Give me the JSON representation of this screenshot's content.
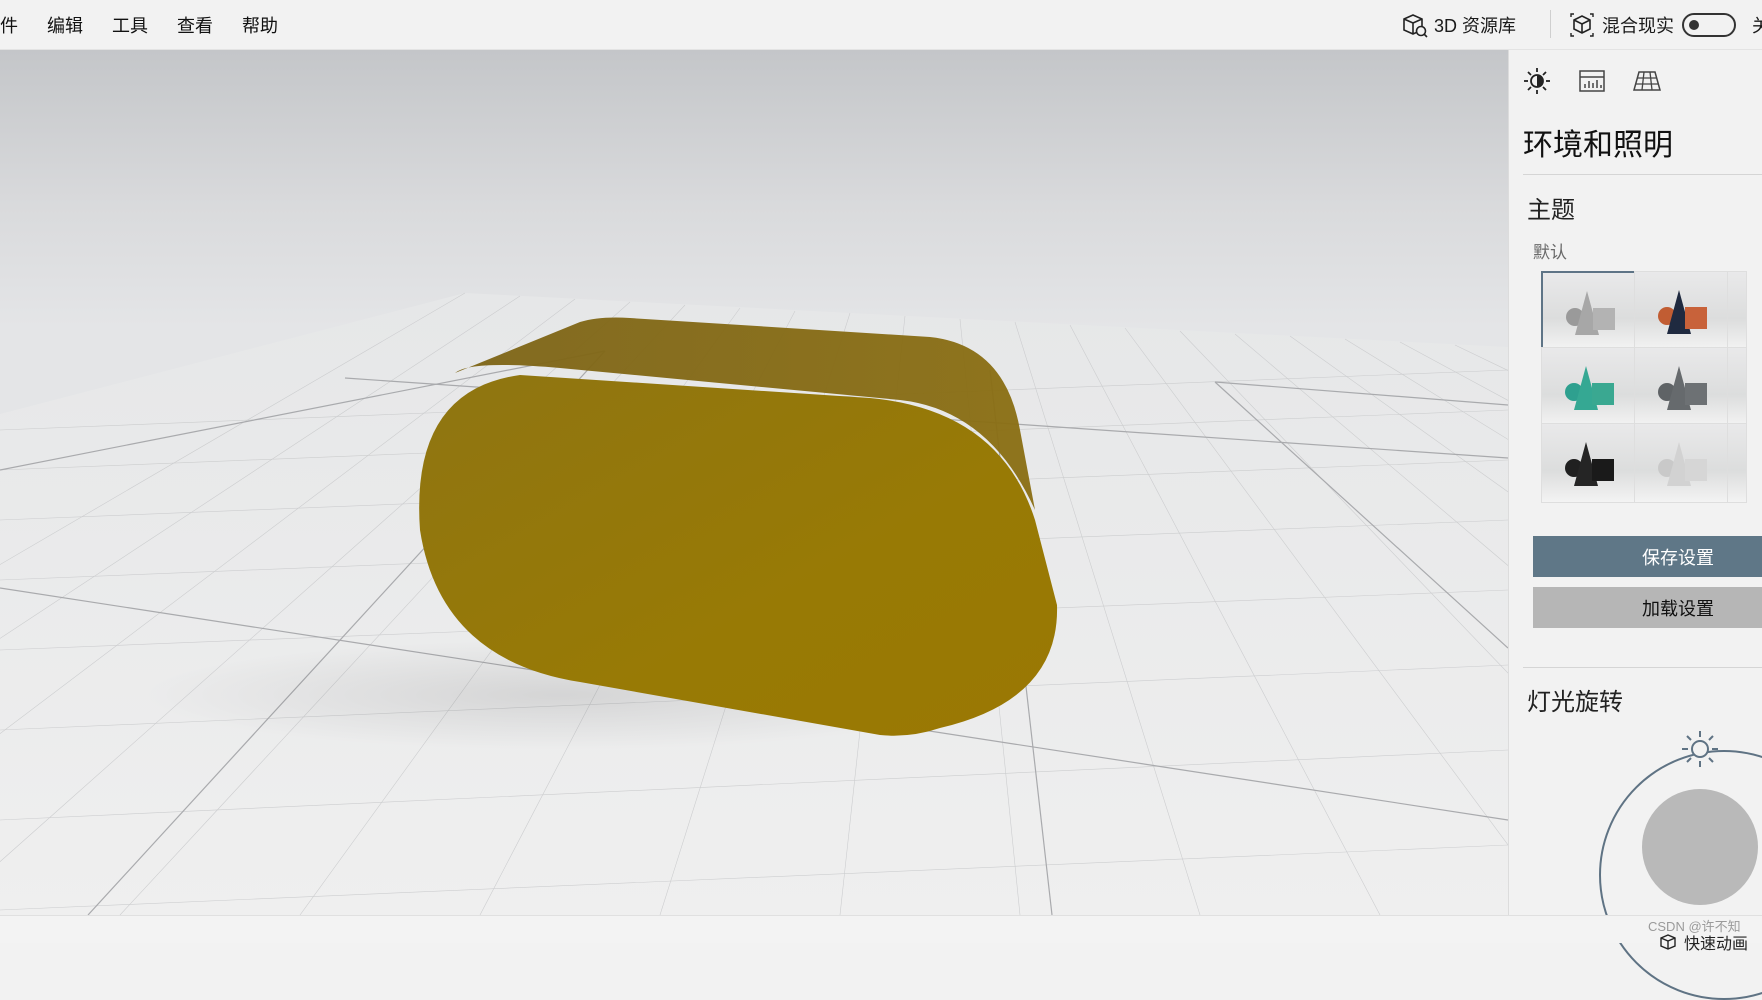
{
  "menu": {
    "items": [
      "件",
      "编辑",
      "工具",
      "查看",
      "帮助"
    ]
  },
  "toolbar": {
    "library_label": "3D 资源库",
    "library_icon": "cube-library-icon",
    "mixed_reality_label": "混合现实",
    "mixed_reality_icon": "mixed-reality-icon",
    "mixed_reality_on": false,
    "toggle_label_partial": "关"
  },
  "viewport": {
    "object_color": "#9a7804",
    "object_shape": "rounded capsule box"
  },
  "panel": {
    "tabs": [
      {
        "icon": "lighting-sun-icon",
        "active": true
      },
      {
        "icon": "stats-chart-icon",
        "active": false
      },
      {
        "icon": "grid-floor-icon",
        "active": false
      }
    ],
    "title": "环境和照明",
    "theme_title": "主题",
    "theme_sub": "默认",
    "themes": [
      {
        "name": "grey",
        "colors": [
          "#9a9a9a",
          "#a7a7a7",
          "#b3b3b3"
        ],
        "selected": true
      },
      {
        "name": "navy-orange",
        "colors": [
          "#c15d33",
          "#1f2a40",
          "#c8623a"
        ],
        "selected": false
      },
      {
        "name": "teal",
        "colors": [
          "#2ea08f",
          "#35a893",
          "#3aa891"
        ],
        "selected": false
      },
      {
        "name": "dark-grey",
        "colors": [
          "#5f6366",
          "#666a6d",
          "#6d7174"
        ],
        "selected": false
      },
      {
        "name": "black",
        "colors": [
          "#202020",
          "#252525",
          "#1a1a1a"
        ],
        "selected": false
      },
      {
        "name": "light",
        "colors": [
          "#c9c9c9",
          "#d2d2d2",
          "#d6d6d6"
        ],
        "selected": false
      }
    ],
    "save_label": "保存设置",
    "load_label": "加载设置",
    "light_rotation_title": "灯光旋转"
  },
  "status": {
    "watermark": "CSDN @许不知",
    "quick_animation_label": "快速动画"
  }
}
